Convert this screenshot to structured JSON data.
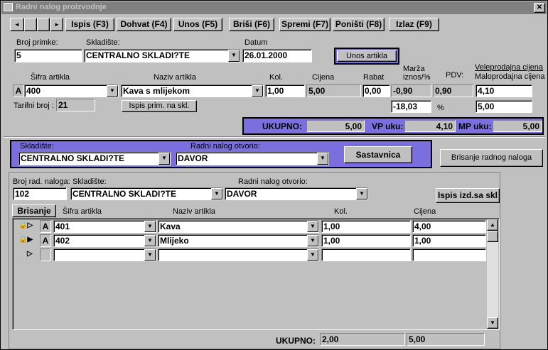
{
  "window": {
    "title": "Radni nalog proizvodnje",
    "close": "✕"
  },
  "toolbar": {
    "first": "◄",
    "blank": "",
    "next": "►",
    "ispis": "Ispis (F3)",
    "dohvat": "Dohvat (F4)",
    "unos": "Unos (F5)",
    "brisi": "Briši (F6)",
    "spremi": "Spremi (F7)",
    "ponisti": "Poništi (F8)",
    "izlaz": "Izlaz (F9)"
  },
  "header": {
    "broj_primke_label": "Broj primke:",
    "broj_primke": "5",
    "skladiste_label": "Skladište:",
    "skladiste": "CENTRALNO SKLADI?TE",
    "datum_label": "Datum",
    "datum": "26.01.2000",
    "unos_artikla": "Unos artikla"
  },
  "article": {
    "sifra_label": "Šifra artikla",
    "naziv_label": "Naziv artikla",
    "kol_label": "Kol.",
    "cijena_label": "Cijena",
    "rabat_label": "Rabat",
    "marza_label": "Marža\niznos/%",
    "pdv_label": "PDV:",
    "vp_label": "Veleprodajna cijena",
    "mp_label": "Maloprodajna cijena",
    "prefix": "A",
    "sifra": "400",
    "naziv": "Kava s mlijekom",
    "kol": "1,00",
    "cijena": "5,00",
    "rabat": "0,00",
    "marza_iznos": "-0,90",
    "pdv": "0,90",
    "vp": "4,10",
    "marza_pct": "-18,03",
    "pct_sign": "%",
    "mp": "5,00",
    "tarifni_label": "Tarifni broj :",
    "tarifni": "21",
    "ispis_prim": "Ispis prim. na skl."
  },
  "totals": {
    "ukupno_label": "UKUPNO:",
    "ukupno": "5,00",
    "vp_label": "VP uku:",
    "vp": "4,10",
    "mp_label": "MP uku:",
    "mp": "5,00"
  },
  "nalog": {
    "skladiste_label": "Skladište:",
    "skladiste": "CENTRALNO SKLADI?TE",
    "otvorio_label": "Radni nalog otvorio:",
    "otvorio": "DAVOR",
    "sastavnica": "Sastavnica",
    "brisanje": "Brisanje radnog naloga"
  },
  "lower": {
    "broj_label": "Broj rad. naloga:",
    "broj": "102",
    "skladiste_label": "Skladište:",
    "skladiste": "CENTRALNO SKLADI?TE",
    "otvorio_label": "Radni nalog otvorio:",
    "otvorio": "DAVOR",
    "ispis_btn": "Ispis izd.sa skl",
    "brisanje_btn": "Brisanje",
    "col_sifra": "Šifra artikla",
    "col_naziv": "Naziv artikla",
    "col_kol": "Kol.",
    "col_cijena": "Cijena",
    "rows": [
      {
        "sel": "🔒▷",
        "prefix": "A",
        "sifra": "401",
        "naziv": "Kava",
        "kol": "1,00",
        "cijena": "4,00"
      },
      {
        "sel": "🔒▶",
        "prefix": "A",
        "sifra": "402",
        "naziv": "Mlijeko",
        "kol": "1,00",
        "cijena": "1,00"
      },
      {
        "sel": "▷",
        "prefix": "",
        "sifra": "",
        "naziv": "",
        "kol": "",
        "cijena": ""
      }
    ],
    "ukupno_label": "UKUPNO:",
    "ukupno_kol": "2,00",
    "ukupno_cijena": "5,00"
  }
}
